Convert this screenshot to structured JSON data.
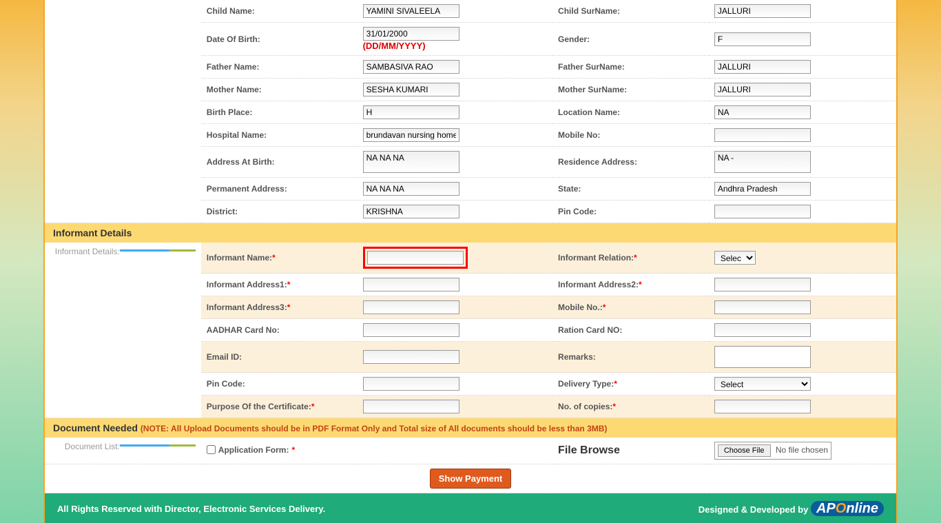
{
  "childDetails": {
    "childNameLabel": "Child Name:",
    "childName": "YAMINI SIVALEELA",
    "childSurnameLabel": "Child SurName:",
    "childSurname": "JALLURI",
    "dobLabel": "Date Of Birth:",
    "dob": "31/01/2000",
    "dobHint": "(DD/MM/YYYY)",
    "genderLabel": "Gender:",
    "gender": "F",
    "fatherNameLabel": "Father Name:",
    "fatherName": "SAMBASIVA RAO",
    "fatherSurnameLabel": "Father SurName:",
    "fatherSurname": "JALLURI",
    "motherNameLabel": "Mother Name:",
    "motherName": "SESHA KUMARI",
    "motherSurnameLabel": "Mother SurName:",
    "motherSurname": "JALLURI",
    "birthPlaceLabel": "Birth Place:",
    "birthPlace": "H",
    "locationNameLabel": "Location Name:",
    "locationName": "NA",
    "hospitalNameLabel": "Hospital Name:",
    "hospitalName": "brundavan nursing home",
    "mobileNoLabel": "Mobile No:",
    "mobileNo": "",
    "addressAtBirthLabel": "Address At Birth:",
    "addressAtBirth": "NA NA NA",
    "residenceAddressLabel": "Residence Address:",
    "residenceAddress": "NA -",
    "permanentAddressLabel": "Permanent Address:",
    "permanentAddress": "NA NA NA",
    "stateLabel": "State:",
    "state": "Andhra Pradesh",
    "districtLabel": "District:",
    "district": "KRISHNA",
    "pincodeLabel": "Pin Code:",
    "pincode": ""
  },
  "informant": {
    "sectionTitle": "Informant Details",
    "sideLabel": "Informant Details:",
    "nameLabel": "Informant Name:",
    "relationLabel": "Informant Relation:",
    "relationValue": "Select",
    "addr1Label": "Informant Address1:",
    "addr2Label": "Informant Address2:",
    "addr3Label": "Informant Address3:",
    "mobileLabel": "Mobile No.:",
    "aadharLabel": "AADHAR Card No:",
    "rationLabel": "Ration Card NO:",
    "emailLabel": "Email ID:",
    "remarksLabel": "Remarks:",
    "pincodeLabel": "Pin Code:",
    "deliveryTypeLabel": "Delivery Type:",
    "deliveryTypeValue": "Select",
    "purposeLabel": "Purpose Of the Certificate:",
    "copiesLabel": "No. of copies:"
  },
  "document": {
    "sectionTitle": "Document Needed",
    "note": "(NOTE: All Upload Documents should be in PDF Format Only and Total size of All documents should be less than 3MB)",
    "sideLabel": "Document List:",
    "appFormLabel": "Application Form:",
    "fileBrowseLabel": "File Browse",
    "chooseFile": "Choose File",
    "noFile": "No file chosen"
  },
  "buttons": {
    "showPayment": "Show Payment"
  },
  "footer": {
    "left": "All Rights Reserved with Director, Electronic Services Delivery.",
    "right": "Designed & Developed by"
  }
}
